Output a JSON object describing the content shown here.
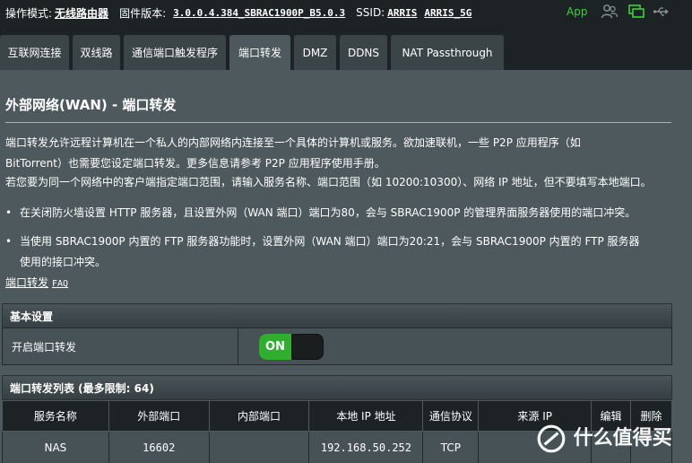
{
  "status": {
    "mode_label": "操作模式:",
    "mode_value": "无线路由器",
    "firmware_label": "固件版本:",
    "firmware_value": "3.0.0.4.384_SBRAC1900P_B5.0.3",
    "ssid_label": "SSID:",
    "ssid_1": "ARRIS",
    "ssid_2": "ARRIS_5G",
    "app_label": "App",
    "icons": [
      "users-icon",
      "network-icon",
      "usb-icon"
    ]
  },
  "tabs": [
    {
      "label": "互联网连接"
    },
    {
      "label": "双线路"
    },
    {
      "label": "通信端口触发程序"
    },
    {
      "label": "端口转发",
      "active": true
    },
    {
      "label": "DMZ"
    },
    {
      "label": "DDNS"
    },
    {
      "label": "NAT Passthrough"
    }
  ],
  "page": {
    "title": "外部网络(WAN) - 端口转发",
    "desc_line1": "端口转发允许远程计算机在一个私人的内部网络内连接至一个具体的计算机或服务。欲加速联机，一些 P2P 应用程序（如",
    "desc_line2": "BitTorrent）也需要您设定端口转发。更多信息请参考 P2P 应用程序使用手册。",
    "desc_line3": "若您要为同一个网络中的客户端指定端口范围，请输入服务名称、端口范围（如 10200:10300）、网络 IP 地址，但不要填写本地端口。",
    "bullet_1": "在关闭防火墙设置 HTTP 服务器，且设置外网（WAN 端口）端口为80，会与 SBRAC1900P 的管理界面服务器使用的端口冲突。",
    "bullet_2_line1": "当使用 SBRAC1900P 内置的 FTP 服务器功能时，设置外网（WAN 端口）端口为20:21，会与 SBRAC1900P 内置的 FTP 服务器",
    "bullet_2_line2": "使用的接口冲突。",
    "bullet_symbol": "•",
    "faq_text": "端口转发",
    "faq_tag": "FAQ"
  },
  "basic": {
    "header": "基本设置",
    "enable_label": "开启端口转发",
    "toggle_on_label": "ON",
    "enabled": true
  },
  "list": {
    "header": "端口转发列表 (最多限制: 64)",
    "columns": [
      "服务名称",
      "外部端口",
      "内部端口",
      "本地 IP 地址",
      "通信协议",
      "来源 IP",
      "编辑",
      "删除"
    ],
    "rows": [
      [
        "NAS",
        "16602",
        "",
        "192.168.50.252",
        "TCP",
        "",
        "",
        ""
      ]
    ]
  },
  "watermark": "什么值得买",
  "colors": {
    "background": "#4d595d",
    "topbar": "#1d2325",
    "toggle_on": "#2fae2f",
    "app_green": "#3bd23b"
  }
}
